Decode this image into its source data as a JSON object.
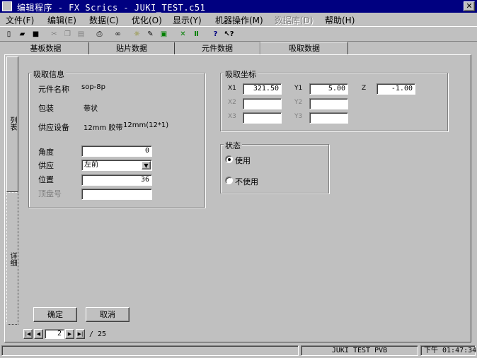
{
  "window": {
    "title": "编辑程序 - FX Scrics - JUKI_TEST.c51",
    "close_symbol": "✕"
  },
  "menu": [
    {
      "label": "文件(F)",
      "disabled": false
    },
    {
      "label": "编辑(E)",
      "disabled": false
    },
    {
      "label": "数据(C)",
      "disabled": false
    },
    {
      "label": "优化(O)",
      "disabled": false
    },
    {
      "label": "显示(Y)",
      "disabled": false
    },
    {
      "label": "机器操作(M)",
      "disabled": false
    },
    {
      "label": "数据库(D)",
      "disabled": true
    },
    {
      "label": "帮助(H)",
      "disabled": false
    }
  ],
  "toolbar": {
    "icons": [
      "new-file-icon",
      "open-folder-icon",
      "save-icon",
      "cut-icon",
      "copy-icon",
      "paste-icon",
      "print-icon",
      "find-icon",
      "light-icon",
      "component-icon",
      "transfer-icon",
      "align-icon",
      "frame-icon",
      "help-icon",
      "context-help-icon"
    ],
    "glyphs": [
      "▯",
      "▰",
      "■",
      "✂",
      "❐",
      "▤",
      "⎙",
      "∞",
      "☼",
      "✎",
      "▣",
      "✕",
      "Ⅱ",
      "?",
      "↖?"
    ]
  },
  "tabs": [
    {
      "label": "基板数据",
      "active": false
    },
    {
      "label": "贴片数据",
      "active": false
    },
    {
      "label": "元件数据",
      "active": false
    },
    {
      "label": "吸取数据",
      "active": true
    }
  ],
  "side_tabs": {
    "top": "列表",
    "bottom": "详细"
  },
  "pick_info": {
    "title": "吸取信息",
    "part_name_label": "元件名称",
    "part_name": "sop-8p",
    "package_label": "包装",
    "package": "带状",
    "feeder_label": "供应设备",
    "feeder_1": "12mm 胶带",
    "feeder_2": "12mm(12*1)",
    "angle_label": "角度",
    "angle_value": "0",
    "supply_label": "供应",
    "supply_value": "左前",
    "position_label": "位置",
    "position_value": "36",
    "tray_label": "顶盘号",
    "tray_value": ""
  },
  "pick_coords": {
    "title": "吸取坐标",
    "x1_label": "X1",
    "x1": "321.50",
    "y1_label": "Y1",
    "y1": "5.00",
    "z_label": "Z",
    "z": "-1.00",
    "x2_label": "X2",
    "x2": "",
    "y2_label": "Y2",
    "y2": "",
    "x3_label": "X3",
    "x3": "",
    "y3_label": "Y3",
    "y3": ""
  },
  "status_group": {
    "title": "状态",
    "use_label": "使用",
    "unused_label": "不使用",
    "selected": "使用"
  },
  "buttons": {
    "ok": "确定",
    "cancel": "取消"
  },
  "pager": {
    "current": "2",
    "total": "/ 25",
    "first": "|◀",
    "prev": "◀",
    "next": "▶",
    "last": "▶|"
  },
  "statusbar": {
    "machine": "JUKI TEST PVB",
    "time": "下午 01:47:34"
  }
}
